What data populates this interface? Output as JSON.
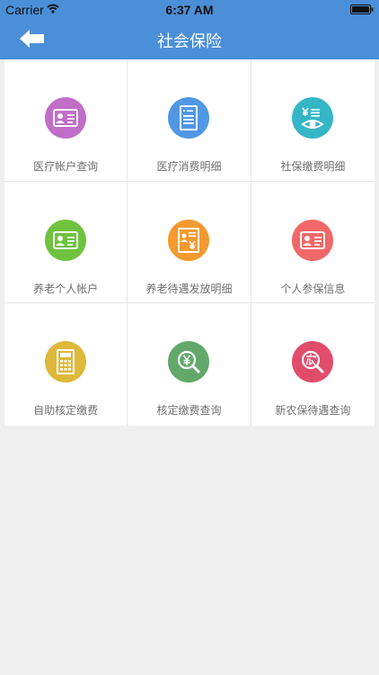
{
  "status_bar": {
    "carrier": "Carrier",
    "time": "6:37 AM"
  },
  "nav": {
    "title": "社会保险",
    "back_icon": "back-arrow-icon"
  },
  "colors": {
    "nav_bg": "#4a8fd8",
    "purple": "#c06ec7",
    "blue": "#5097e4",
    "teal": "#35b6c6",
    "green": "#6fc23e",
    "orange": "#f49a2f",
    "red": "#f26868",
    "gold": "#deb83a",
    "olive": "#62a86a",
    "crimson": "#e14c6c"
  },
  "items": [
    {
      "label": "医疗帐户查询",
      "icon": "id-card-icon"
    },
    {
      "label": "医疗消费明细",
      "icon": "receipt-icon"
    },
    {
      "label": "社保缴费明细",
      "icon": "yuan-list-icon"
    },
    {
      "label": "养老个人帐户",
      "icon": "id-card-icon"
    },
    {
      "label": "养老待遇发放明细",
      "icon": "document-yuan-icon"
    },
    {
      "label": "个人参保信息",
      "icon": "id-card-icon"
    },
    {
      "label": "自助核定缴费",
      "icon": "calculator-icon"
    },
    {
      "label": "核定缴费查询",
      "icon": "yuan-search-icon"
    },
    {
      "label": "新农保待遇查询",
      "icon": "nong-search-icon"
    }
  ]
}
